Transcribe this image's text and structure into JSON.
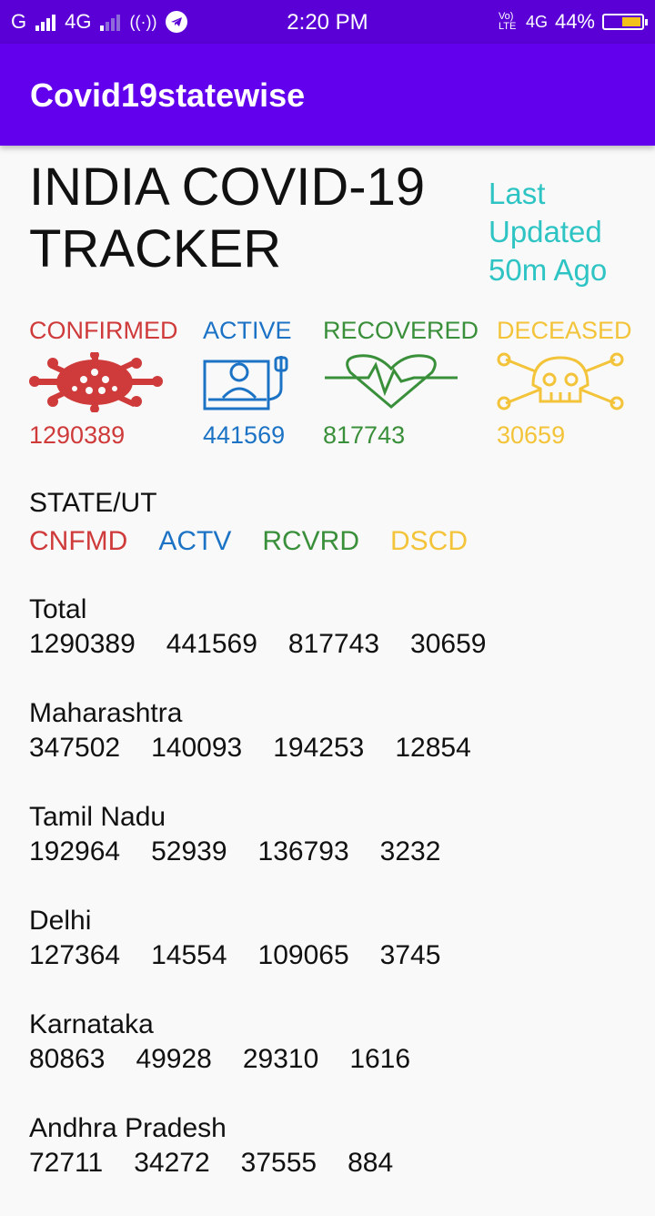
{
  "status_bar": {
    "network_left": "G",
    "network_label": "4G",
    "time": "2:20 PM",
    "volte": "Vo) LTE",
    "network_right": "4G",
    "battery": "44%"
  },
  "app": {
    "title": "Covid19statewise"
  },
  "header": {
    "title": "INDIA COVID-19 TRACKER",
    "updated": "Last Updated 50m Ago"
  },
  "stats": [
    {
      "label": "CONFIRMED",
      "value": "1290389",
      "icon": "virus-icon",
      "color": "#cf3a3a"
    },
    {
      "label": "ACTIVE",
      "value": "441569",
      "icon": "hospital-bed-icon",
      "color": "#1c73c5"
    },
    {
      "label": "RECOVERED",
      "value": "817743",
      "icon": "heartbeat-icon",
      "color": "#3a8f3a"
    },
    {
      "label": "DECEASED",
      "value": "30659",
      "icon": "skull-icon",
      "color": "#f3c43a"
    }
  ],
  "legend": {
    "heading": "STATE/UT",
    "confirmed": "CNFMD",
    "active": "ACTV",
    "recovered": "RCVRD",
    "deceased": "DSCD"
  },
  "rows": [
    {
      "name": "Total",
      "confirmed": "1290389",
      "active": "441569",
      "recovered": "817743",
      "deceased": "30659"
    },
    {
      "name": "Maharashtra",
      "confirmed": "347502",
      "active": "140093",
      "recovered": "194253",
      "deceased": "12854"
    },
    {
      "name": "Tamil Nadu",
      "confirmed": "192964",
      "active": "52939",
      "recovered": "136793",
      "deceased": "3232"
    },
    {
      "name": "Delhi",
      "confirmed": "127364",
      "active": "14554",
      "recovered": "109065",
      "deceased": "3745"
    },
    {
      "name": "Karnataka",
      "confirmed": "80863",
      "active": "49928",
      "recovered": "29310",
      "deceased": "1616"
    },
    {
      "name": "Andhra Pradesh",
      "confirmed": "72711",
      "active": "34272",
      "recovered": "37555",
      "deceased": "884"
    }
  ]
}
